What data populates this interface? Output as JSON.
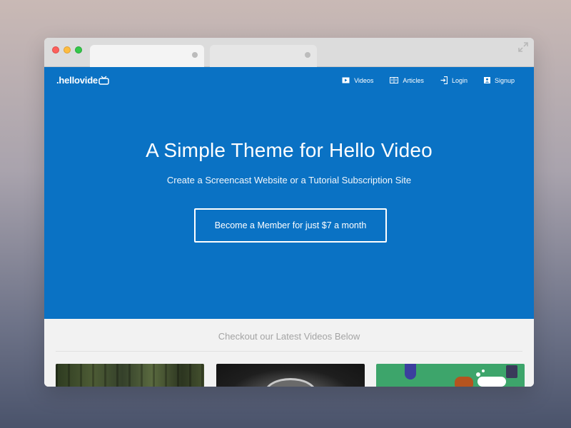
{
  "brand": {
    "logo_text": ".hellovide",
    "primary_color": "#0a72c4"
  },
  "nav": {
    "items": [
      {
        "label": "Videos",
        "icon": "video-icon"
      },
      {
        "label": "Articles",
        "icon": "book-icon"
      },
      {
        "label": "Login",
        "icon": "login-icon"
      },
      {
        "label": "Signup",
        "icon": "user-icon"
      }
    ]
  },
  "hero": {
    "title": "A Simple Theme for Hello Video",
    "subtitle": "Create a Screencast Website or a Tutorial Subscription Site",
    "cta_label": "Become a Member for just $7 a month"
  },
  "latest": {
    "heading": "Checkout our Latest Videos Below"
  }
}
